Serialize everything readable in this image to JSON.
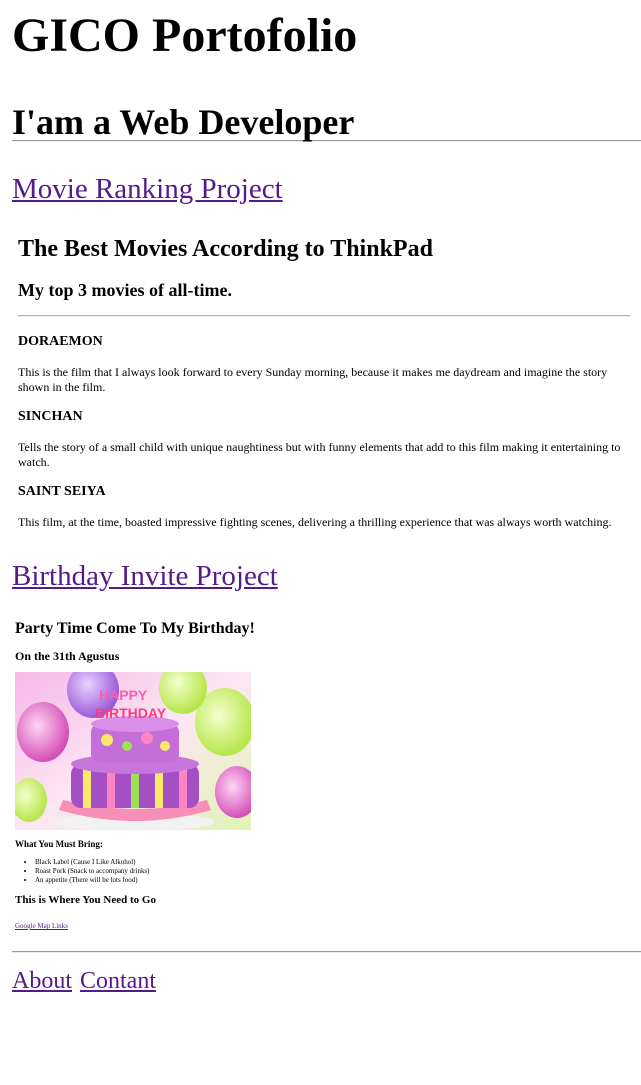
{
  "header": {
    "title": "GICO Portofolio",
    "subtitle": "I'am a Web Developer"
  },
  "projects": {
    "movie_link": "Movie Ranking Project",
    "birthday_link": "Birthday Invite Project"
  },
  "movie_page": {
    "title": "The Best Movies According to ThinkPad",
    "subtitle": "My top 3 movies of all-time.",
    "movies": [
      {
        "name": "DORAEMON",
        "description": "This is the film that I always look forward to every Sunday morning, because it makes me daydream and imagine the story shown in the film."
      },
      {
        "name": "SINCHAN",
        "description": "Tells the story of a small child with unique naughtiness but with funny elements that add to this film making it entertaining to watch."
      },
      {
        "name": "SAINT SEIYA",
        "description": "This film, at the time, boasted impressive fighting scenes, delivering a thrilling experience that was always worth watching."
      }
    ]
  },
  "invite_page": {
    "title": "Party Time Come To My Birthday!",
    "date": "On the 31th Agustus",
    "cake_image_icon": "birthday-cake-image",
    "bring_heading": "What You Must Bring:",
    "bring_items": [
      "Black Label (Cause I Like Alkohol)",
      "Roast Pork (Snack to accompany drinks)",
      "An appetite (There will be lots food)"
    ],
    "where_heading": "This is Where You Need to Go",
    "map_link": "Google Map Links"
  },
  "footer": {
    "about": "About",
    "contact": "Contant"
  },
  "colors": {
    "link_visited": "#551a8b",
    "text": "#000000",
    "background": "#ffffff"
  }
}
